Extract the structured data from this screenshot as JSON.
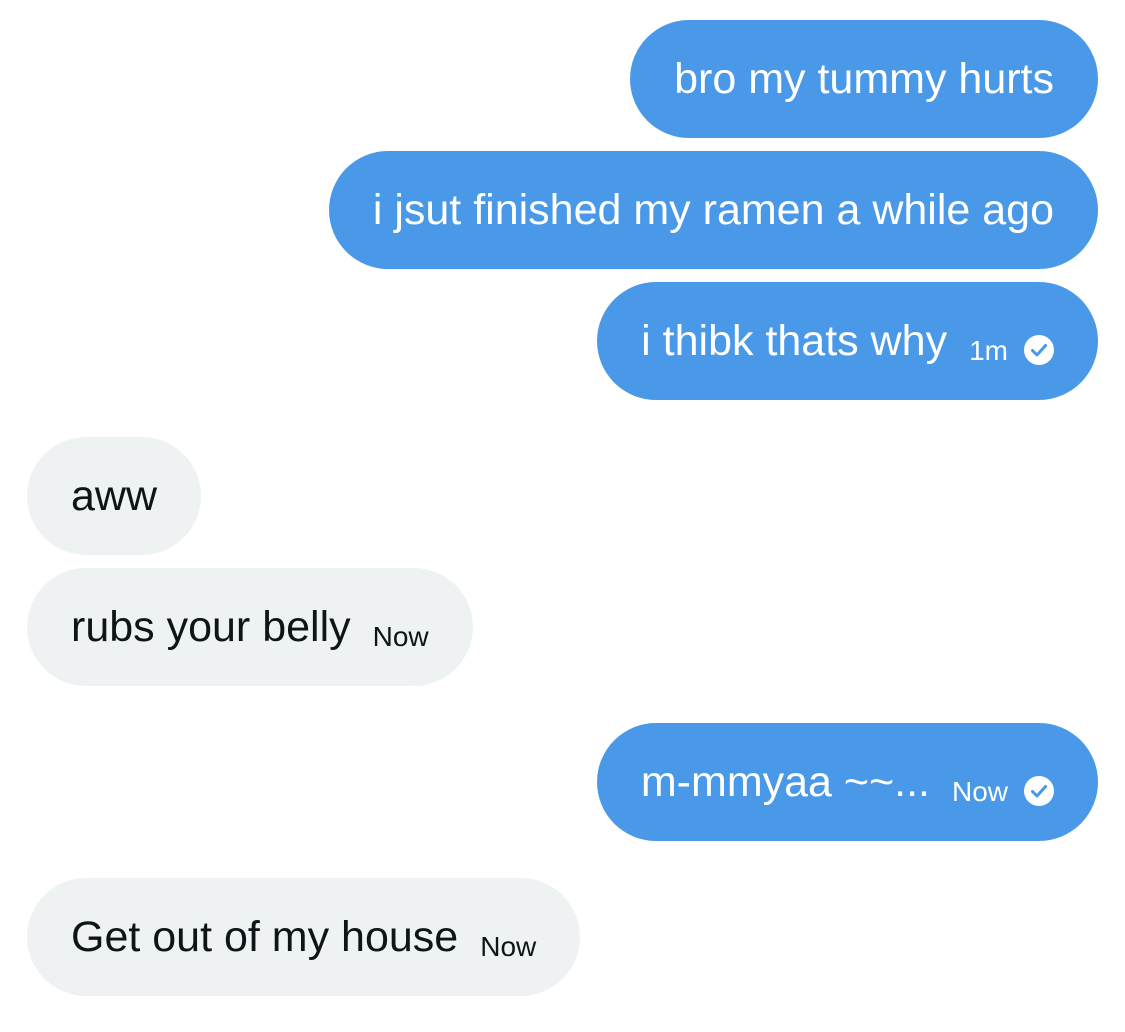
{
  "colors": {
    "sent_bubble": "#4a99e9",
    "received_bubble": "#eff2f3",
    "sent_text": "#ffffff",
    "received_text": "#0f1419"
  },
  "messages": [
    {
      "direction": "sent",
      "text": "bro my tummy hurts"
    },
    {
      "direction": "sent",
      "text": "i jsut finished my ramen a while ago"
    },
    {
      "direction": "sent",
      "text": "i thibk thats why",
      "time": "1m",
      "status_icon": "read-check-icon"
    },
    {
      "direction": "received",
      "text": "aww"
    },
    {
      "direction": "received",
      "text": "rubs your belly",
      "time": "Now"
    },
    {
      "direction": "sent",
      "text": "m-mmyaa ~~...",
      "time": "Now",
      "status_icon": "read-check-icon"
    },
    {
      "direction": "received",
      "text": "Get out of my house",
      "time": "Now"
    }
  ]
}
